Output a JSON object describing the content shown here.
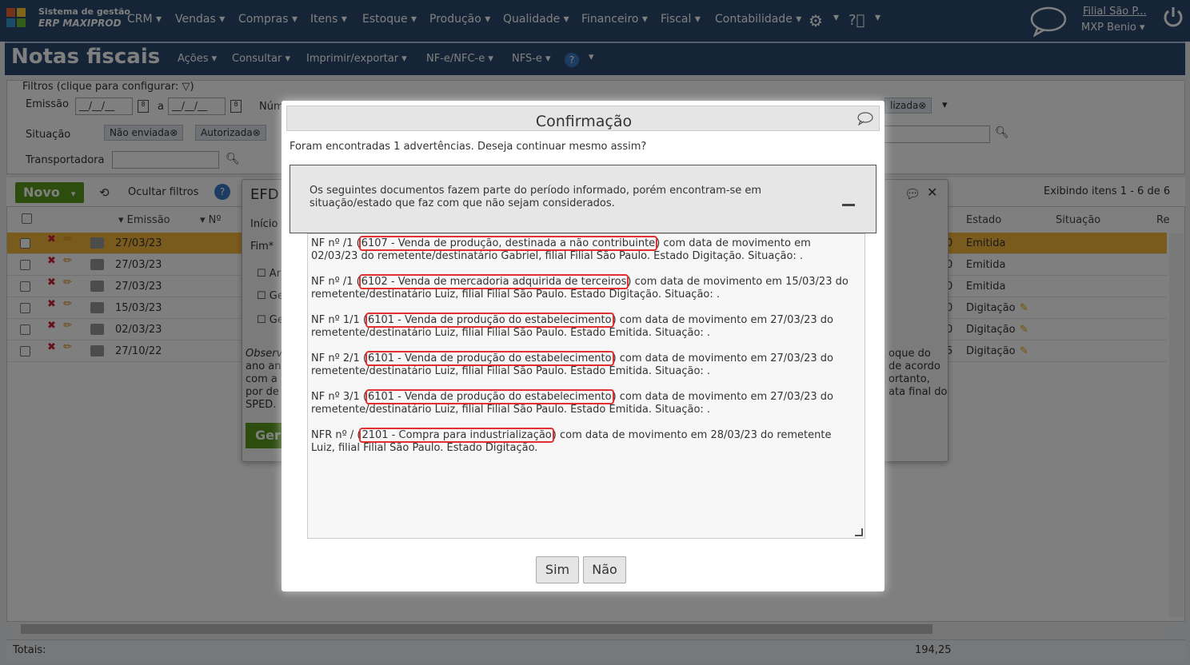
{
  "app": {
    "logo_line1": "Sistema de gestão",
    "logo_line2": "ERP MAXIPROD",
    "nav": [
      "CRM",
      "Vendas",
      "Compras",
      "Itens",
      "Estoque",
      "Produção",
      "Qualidade",
      "Financeiro",
      "Fiscal",
      "Contabilidade"
    ],
    "branch": "Filial São P...",
    "user": "MXP Benio"
  },
  "page": {
    "title": "Notas fiscais",
    "menus": [
      "Ações",
      "Consultar",
      "Imprimir/exportar",
      "NF-e/NFC-e",
      "NFS-e"
    ]
  },
  "filters": {
    "legend": "Filtros (clique para configurar:",
    "emissao_label": "Emissão",
    "date_from": "__/__/__",
    "a_label": "a",
    "date_to": "__/__/__",
    "num_label": "Núm",
    "situacao_label": "Situação",
    "situacao_chips": [
      "Não enviada",
      "Autorizada"
    ],
    "right_chip": "lizada",
    "transportadora_label": "Transportadora"
  },
  "grid": {
    "novo": "Novo",
    "hide_filters": "Ocultar filtros",
    "showing": "Exibindo itens 1 - 6 de 6",
    "headers": {
      "emissao": "Emissão",
      "numero": "Nº",
      "estado": "Estado",
      "situacao": "Situação",
      "re": "Re"
    },
    "rows": [
      {
        "date": "27/03/23",
        "estado": "Emitida",
        "edge": "0"
      },
      {
        "date": "27/03/23",
        "estado": "Emitida",
        "edge": "0"
      },
      {
        "date": "27/03/23",
        "estado": "Emitida",
        "edge": "0"
      },
      {
        "date": "15/03/23",
        "estado": "Digitação",
        "edge": "0"
      },
      {
        "date": "02/03/23",
        "estado": "Digitação",
        "edge": "0"
      },
      {
        "date": "27/10/22",
        "estado": "Digitação",
        "edge": "5"
      }
    ],
    "totals_label": "Totais:",
    "totals_value": "194,25"
  },
  "efd": {
    "title": "EFD",
    "inicio": "Início",
    "fim": "Fim*",
    "cb1": "Ar",
    "cb2": "Ge",
    "cb3": "Ge",
    "obs_left": [
      "Observ",
      "ano an",
      "com a",
      "por de",
      "SPED."
    ],
    "obs_right": [
      "oque do",
      "de acordo",
      "ortanto,",
      "ata final do"
    ],
    "btn": "Ger"
  },
  "modal": {
    "title": "Confirmação",
    "intro": "Foram encontradas 1 advertências. Deseja continuar mesmo assim?",
    "warning": "Os seguintes documentos fazem parte do período informado, porém encontram-se em situação/estado que faz com que não sejam considerados.",
    "items": [
      {
        "pre": "NF nº /1 (",
        "cfop": "6107 - Venda de produção, destinada a não contribuinte",
        "post": ") com data de movimento em 02/03/23 do remetente/destinatário Gabriel, filial Filial São Paulo. Estado Digitação. Situação: ."
      },
      {
        "pre": "NF nº /1 (",
        "cfop": "6102 - Venda de mercadoria adquirida de terceiros",
        "post": ") com data de movimento em 15/03/23 do remetente/destinatário Luiz, filial Filial São Paulo. Estado Digitação. Situação: ."
      },
      {
        "pre": "NF nº 1/1 (",
        "cfop": "6101 - Venda de produção do estabelecimento",
        "post": ") com data de movimento em 27/03/23 do remetente/destinatário Luiz, filial Filial São Paulo. Estado Emitida. Situação: ."
      },
      {
        "pre": "NF nº 2/1 (",
        "cfop": "6101 - Venda de produção do estabelecimento",
        "post": ") com data de movimento em 27/03/23 do remetente/destinatário Luiz, filial Filial São Paulo. Estado Emitida. Situação: ."
      },
      {
        "pre": "NF nº 3/1 (",
        "cfop": "6101 - Venda de produção do estabelecimento",
        "post": ") com data de movimento em 27/03/23 do remetente/destinatário Luiz, filial Filial São Paulo. Estado Emitida. Situação: ."
      },
      {
        "pre": "NFR nº / (",
        "cfop": "2101 - Compra para industrialização",
        "post": ") com data de movimento em 28/03/23 do remetente Luiz, filial Filial São Paulo. Estado Digitação."
      }
    ],
    "yes": "Sim",
    "no": "Não"
  },
  "colors": {
    "nav_bg": "#2b4a6e",
    "selected_row": "#f5b73c",
    "novo_green": "#5a9a1e",
    "highlight": "#e03030"
  }
}
